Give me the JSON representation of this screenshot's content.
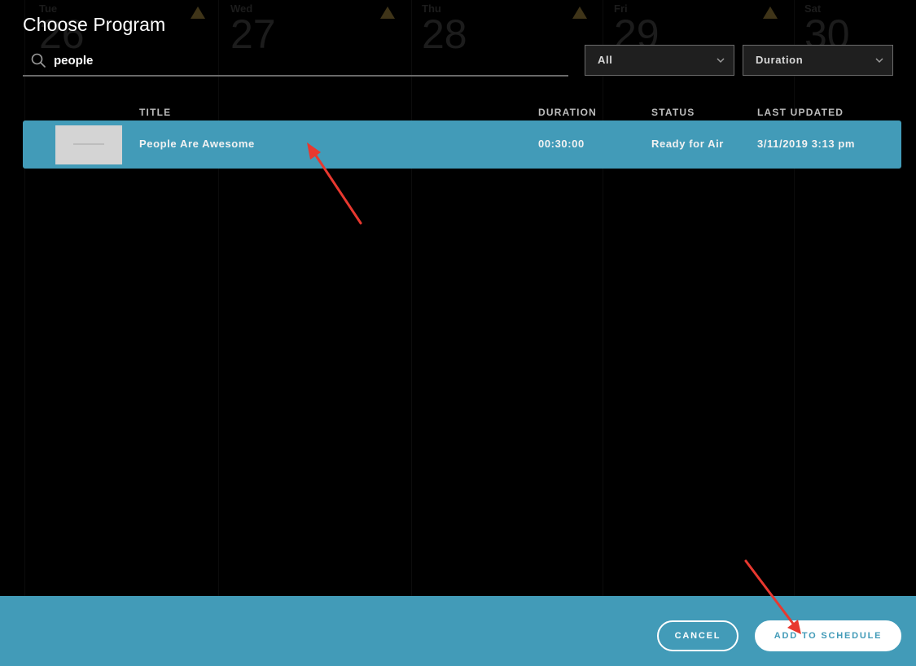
{
  "background_calendar": {
    "days": [
      {
        "dow": "Tue",
        "num": "26"
      },
      {
        "dow": "Wed",
        "num": "27"
      },
      {
        "dow": "Thu",
        "num": "28"
      },
      {
        "dow": "Fri",
        "num": "29"
      },
      {
        "dow": "Sat",
        "num": "30"
      }
    ]
  },
  "dialog": {
    "title": "Choose Program",
    "search": {
      "value": "people",
      "placeholder": ""
    },
    "filters": {
      "type": {
        "selected": "All"
      },
      "sort": {
        "selected": "Duration"
      }
    },
    "columns": {
      "title": "TITLE",
      "duration": "DURATION",
      "status": "STATUS",
      "last_updated": "LAST UPDATED"
    },
    "results": [
      {
        "title": "People Are Awesome",
        "duration": "00:30:00",
        "status": "Ready for Air",
        "last_updated": "3/11/2019 3:13 pm",
        "selected": true
      }
    ]
  },
  "footer": {
    "cancel_label": "CANCEL",
    "add_label": "ADD TO SCHEDULE"
  },
  "colors": {
    "accent": "#429bb8",
    "background": "#000000",
    "annotation_arrow": "#e8382f"
  }
}
